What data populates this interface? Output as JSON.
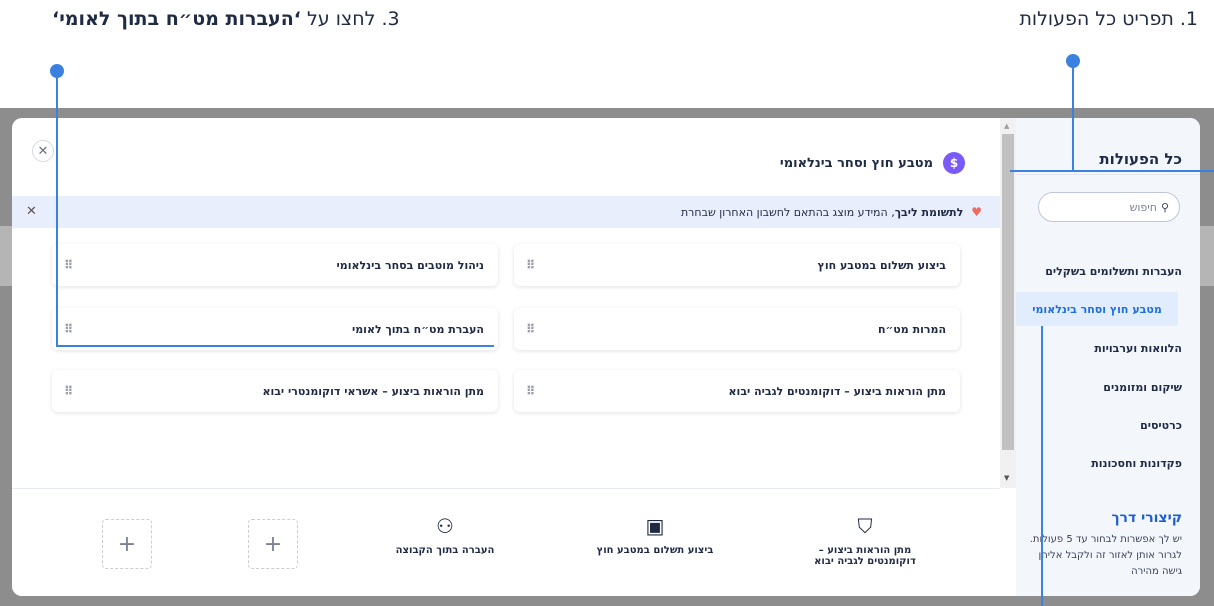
{
  "tutorial": {
    "step3_prefix": "3. לחצו על ",
    "step3_bold": "‘העברות מט״ח בתוך לאומי‘",
    "step1": "1. תפריט כל הפעולות"
  },
  "sidebar": {
    "title": "כל הפעולות",
    "search_placeholder": "חיפוש",
    "items": [
      {
        "label": "העברות ותשלומים בשקלים"
      },
      {
        "label": "מטבע חוץ וסחר בינלאומי"
      },
      {
        "label": "הלוואות וערבויות"
      },
      {
        "label": "שיקום ומזומנים"
      },
      {
        "label": "כרטיסים"
      },
      {
        "label": "פקדונות וחסכונות"
      }
    ]
  },
  "main": {
    "title": "מטבע חוץ וסחר בינלאומי",
    "notice_bold": "לתשומת ליבך",
    "notice_text": ", המידע מוצג בהתאם לחשבון האחרון שבחרת",
    "cards": [
      {
        "label": "ביצוע תשלום במטבע חוץ"
      },
      {
        "label": "ניהול מוטבים בסחר בינלאומי"
      },
      {
        "label": "המרות מט״ח"
      },
      {
        "label": "העברת מט״ח בתוך לאומי"
      },
      {
        "label": "מתן הוראות ביצוע – דוקומנטים לגביה יבוא"
      },
      {
        "label": "מתן הוראות ביצוע – אשראי דוקומנטרי יבוא"
      }
    ]
  },
  "shortcuts": {
    "title": "קיצורי דרך",
    "description": "יש לך אפשרות לבחור עד 5 פעולות. לגרור אותן לאזור זה ולקבל אליהן גישה מהירה",
    "items": [
      {
        "label": "מתן הוראות ביצוע – דוקומנטים לגביה יבוא",
        "icon": "shield-document-icon"
      },
      {
        "label": "ביצוע תשלום במטבע חוץ",
        "icon": "wallet-currency-icon"
      },
      {
        "label": "העברה בתוך הקבוצה",
        "icon": "group-transfer-icon"
      }
    ],
    "add_label": "+"
  },
  "colors": {
    "accent": "#3b82e0",
    "active_bg": "#e1ecfd",
    "active_text": "#1e6ee0",
    "dollar_badge": "#7a5af8",
    "notice_bg": "#e9eefc"
  }
}
